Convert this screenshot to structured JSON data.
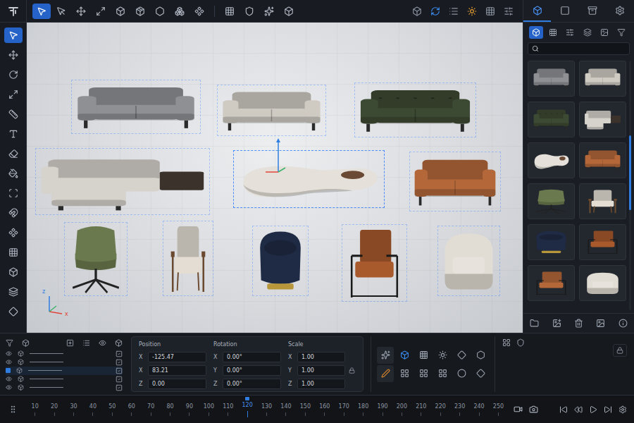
{
  "top_tools": [
    {
      "selected": true
    },
    {
      "selected": false
    },
    {
      "selected": false
    },
    {
      "selected": false
    },
    {
      "selected": false
    },
    {
      "selected": false
    },
    {
      "selected": false
    },
    {
      "selected": false
    },
    {
      "selected": false
    },
    {
      "selected": false
    },
    {
      "selected": false
    },
    {
      "selected": false
    },
    {
      "selected": false
    }
  ],
  "view_tools": [
    {
      "color": "#8a93a0"
    },
    {
      "color": "#3b8cf0"
    },
    {
      "color": "#8a93a0"
    },
    {
      "color": "#e39a2f"
    },
    {
      "color": "#8a93a0"
    },
    {
      "color": "#8a93a0"
    }
  ],
  "left_tools": [
    {
      "selected": true
    },
    {
      "selected": false
    },
    {
      "selected": false
    },
    {
      "selected": false
    },
    {
      "selected": false
    },
    {
      "selected": false
    },
    {
      "selected": false
    },
    {
      "selected": false
    },
    {
      "selected": false
    },
    {
      "selected": false
    },
    {
      "selected": false
    },
    {
      "selected": false
    },
    {
      "selected": false
    },
    {
      "selected": false
    },
    {
      "selected": false
    }
  ],
  "viewport": {
    "objects": [
      {
        "kind": "sofa",
        "color": "#8f9094",
        "selected": false
      },
      {
        "kind": "sofa",
        "color": "#cfcac2",
        "selected": false
      },
      {
        "kind": "tufted-sofa",
        "color": "#3d4a33",
        "selected": false
      },
      {
        "kind": "sectional",
        "color": "#d6d2cc",
        "selected": false
      },
      {
        "kind": "curved-sofa",
        "color": "#e5e1da",
        "selected": true
      },
      {
        "kind": "sofa",
        "color": "#b4683a",
        "selected": false
      },
      {
        "kind": "swivel-chair",
        "color": "#6b7a4e",
        "selected": false
      },
      {
        "kind": "armchair",
        "color": "#e3ddd3",
        "selected": false
      },
      {
        "kind": "barrel-chair",
        "color": "#1f2a44",
        "selected": false
      },
      {
        "kind": "sling-chair",
        "color": "#a85a2c",
        "selected": false
      },
      {
        "kind": "tub-chair",
        "color": "#e2ddd4",
        "selected": false
      }
    ],
    "gizmo_labels": [
      "z",
      "x"
    ]
  },
  "library": {
    "tabs": [
      {
        "selected": true
      },
      {
        "selected": false
      },
      {
        "selected": false
      },
      {
        "selected": false
      }
    ],
    "filters": [
      {
        "selected": true
      },
      {
        "selected": false
      },
      {
        "selected": false
      },
      {
        "selected": false
      },
      {
        "selected": false
      },
      {
        "selected": false
      }
    ],
    "assets": [
      {
        "kind": "sofa",
        "color": "#8f9094"
      },
      {
        "kind": "sofa",
        "color": "#cfcac2"
      },
      {
        "kind": "tufted-sofa",
        "color": "#3d4a33"
      },
      {
        "kind": "sectional",
        "color": "#d6d2cc"
      },
      {
        "kind": "curved-sofa",
        "color": "#e5e1da"
      },
      {
        "kind": "sofa",
        "color": "#b4683a"
      },
      {
        "kind": "swivel-chair",
        "color": "#6b7a4e"
      },
      {
        "kind": "armchair",
        "color": "#e3ddd3"
      },
      {
        "kind": "barrel-chair",
        "color": "#1f2a44"
      },
      {
        "kind": "sling-chair",
        "color": "#a85a2c"
      },
      {
        "kind": "sling-chair",
        "color": "#b4683a"
      },
      {
        "kind": "tub-chair",
        "color": "#e2ddd4"
      }
    ],
    "scroll": {
      "level": 0.3
    }
  },
  "layers": [
    {
      "visible": true,
      "selected": false,
      "checked": true
    },
    {
      "visible": true,
      "selected": false,
      "checked": true
    },
    {
      "visible": true,
      "selected": true,
      "checked": true
    },
    {
      "visible": true,
      "selected": false,
      "checked": true
    },
    {
      "visible": true,
      "selected": false,
      "checked": true
    }
  ],
  "transform": {
    "groups": [
      {
        "label": "Position",
        "fields": [
          {
            "axis": "X",
            "value": "-125.47"
          },
          {
            "axis": "X",
            "value": "83.21"
          },
          {
            "axis": "Z",
            "value": "0.00"
          }
        ]
      },
      {
        "label": "Rotation",
        "fields": [
          {
            "axis": "X",
            "value": "0.00°"
          },
          {
            "axis": "Y",
            "value": "0.00°"
          },
          {
            "axis": "Z",
            "value": "0.00°"
          }
        ]
      },
      {
        "label": "Scale",
        "fields": [
          {
            "axis": "X",
            "value": "1.00"
          },
          {
            "axis": "Y",
            "value": "1.00"
          },
          {
            "axis": "Z",
            "value": "1.00"
          }
        ]
      }
    ],
    "scale_locked": true
  },
  "tools_grid": [
    {
      "color": "#9aa2ae"
    },
    {
      "color": "#3b8cf0"
    },
    {
      "color": "#9aa2ae"
    },
    {
      "color": "#9aa2ae"
    },
    {
      "color": "#9aa2ae"
    },
    {
      "color": "#9aa2ae"
    },
    {
      "color": "#e08a2e"
    },
    {
      "color": "#9aa2ae"
    },
    {
      "color": "#9aa2ae"
    },
    {
      "color": "#9aa2ae"
    },
    {
      "color": "#9aa2ae"
    },
    {
      "color": "#9aa2ae"
    }
  ],
  "timeline": {
    "ticks": [
      {
        "label": "10",
        "selected": false
      },
      {
        "label": "20",
        "selected": false
      },
      {
        "label": "30",
        "selected": false
      },
      {
        "label": "40",
        "selected": false
      },
      {
        "label": "50",
        "selected": false
      },
      {
        "label": "60",
        "selected": false
      },
      {
        "label": "70",
        "selected": false
      },
      {
        "label": "80",
        "selected": false
      },
      {
        "label": "90",
        "selected": false
      },
      {
        "label": "100",
        "selected": false
      },
      {
        "label": "110",
        "selected": false
      },
      {
        "label": "120",
        "selected": true
      },
      {
        "label": "130",
        "selected": false
      },
      {
        "label": "140",
        "selected": false
      },
      {
        "label": "150",
        "selected": false
      },
      {
        "label": "160",
        "selected": false
      },
      {
        "label": "170",
        "selected": false
      },
      {
        "label": "180",
        "selected": false
      },
      {
        "label": "190",
        "selected": false
      },
      {
        "label": "200",
        "selected": false
      },
      {
        "label": "210",
        "selected": false
      },
      {
        "label": "220",
        "selected": false
      },
      {
        "label": "230",
        "selected": false
      },
      {
        "label": "240",
        "selected": false
      },
      {
        "label": "250",
        "selected": false
      }
    ],
    "playing": false
  }
}
